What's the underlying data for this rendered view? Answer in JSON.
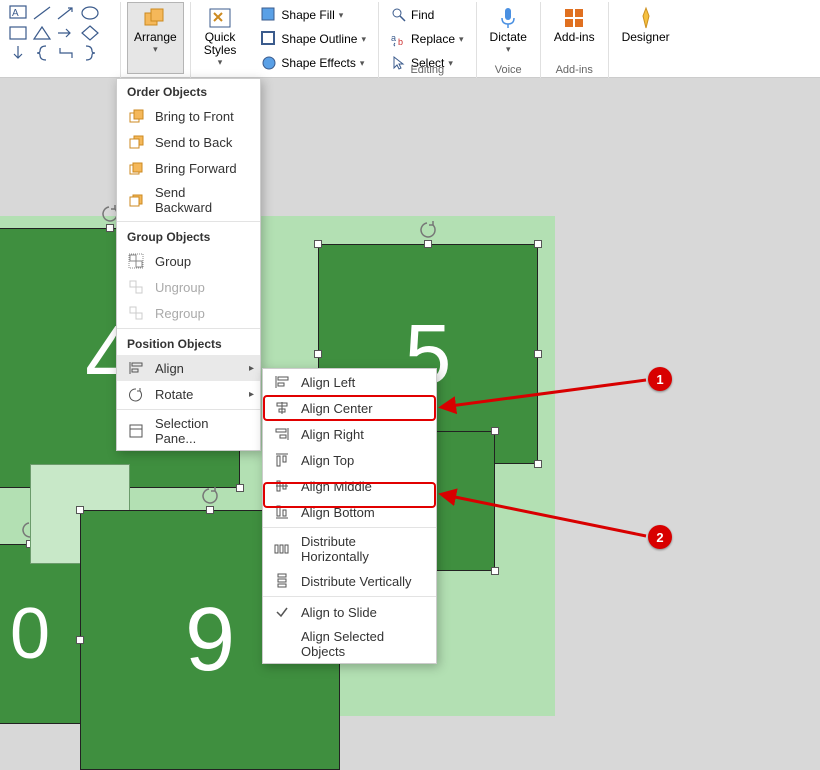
{
  "ribbon": {
    "arrange": "Arrange",
    "quick_styles": "Quick\nStyles",
    "shape_fill": "Shape Fill",
    "shape_outline": "Shape Outline",
    "shape_effects": "Shape Effects",
    "find": "Find",
    "replace": "Replace",
    "select": "Select",
    "editing_group": "Editing",
    "dictate": "Dictate",
    "voice_group": "Voice",
    "addins": "Add-ins",
    "addins_group": "Add-ins",
    "designer": "Designer"
  },
  "arrange_menu": {
    "order_header": "Order Objects",
    "bring_front": "Bring to Front",
    "send_back": "Send to Back",
    "bring_forward": "Bring Forward",
    "send_backward": "Send Backward",
    "group_header": "Group Objects",
    "group": "Group",
    "ungroup": "Ungroup",
    "regroup": "Regroup",
    "position_header": "Position Objects",
    "align": "Align",
    "rotate": "Rotate",
    "selection_pane": "Selection Pane..."
  },
  "align_submenu": {
    "left": "Align Left",
    "center": "Align Center",
    "right": "Align Right",
    "top": "Align Top",
    "middle": "Align Middle",
    "bottom": "Align Bottom",
    "dist_h": "Distribute Horizontally",
    "dist_v": "Distribute Vertically",
    "to_slide": "Align to Slide",
    "selected": "Align Selected Objects"
  },
  "annotations": {
    "a1": "1",
    "a2": "2"
  },
  "tiles": {
    "t0": "0",
    "t4": "4",
    "t5": "5",
    "t9": "9"
  }
}
